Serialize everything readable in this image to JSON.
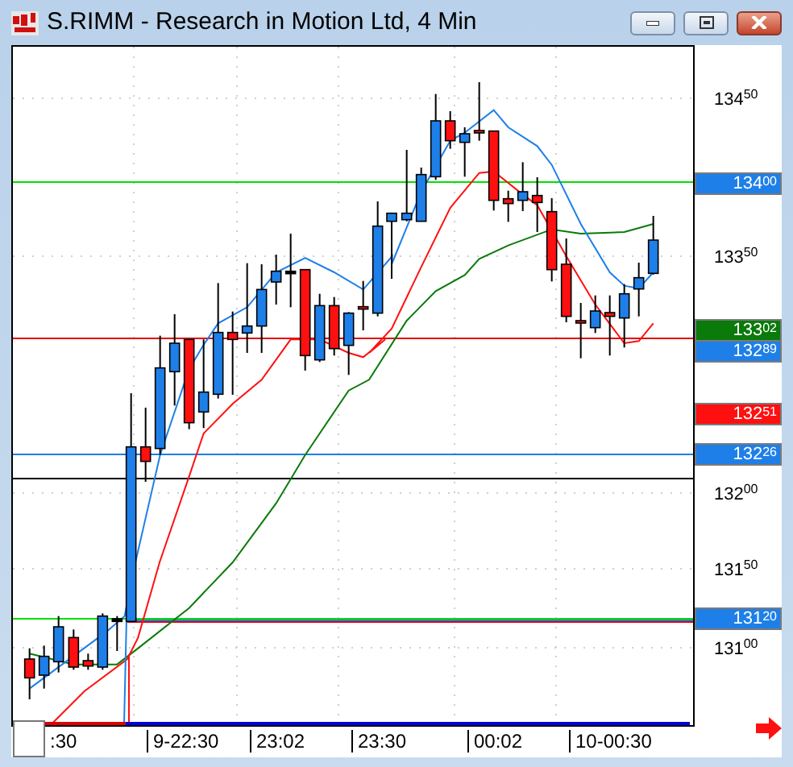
{
  "window": {
    "title": "S.RIMM - Research in Motion Ltd, 4 Min"
  },
  "price_axis": [
    {
      "kind": "plain",
      "text": "134$^{50}$"
    },
    {
      "kind": "tag",
      "text": "134$^{00}$",
      "color": "#1e7fe8"
    },
    {
      "kind": "plain",
      "text": "133$^{50}$"
    },
    {
      "kind": "tag",
      "text": "133$^{02}$",
      "color": "#0a7a0a"
    },
    {
      "kind": "tag",
      "text": "132$^{89}$",
      "color": "#1e7fe8"
    },
    {
      "kind": "tag",
      "text": "132$^{51}$",
      "color": "#ff1010"
    },
    {
      "kind": "tag",
      "text": "132$^{26}$",
      "color": "#1e7fe8"
    },
    {
      "kind": "plain",
      "text": "132$^{00}$"
    },
    {
      "kind": "plain",
      "text": "131$^{50}$"
    },
    {
      "kind": "tag",
      "text": "131$^{20}$",
      "color": "#1e7fe8"
    },
    {
      "kind": "plain",
      "text": "131$^{00}$"
    }
  ],
  "time_axis": [
    ":30",
    "9-22:30",
    "23:02",
    "23:30",
    "00:02",
    "10-00:30"
  ]
}
